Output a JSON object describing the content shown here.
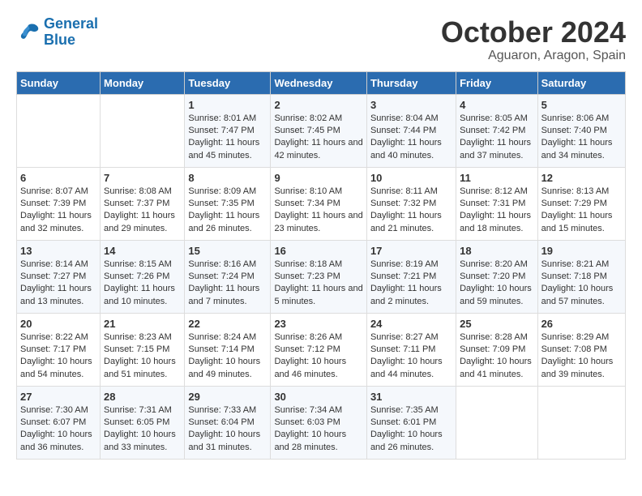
{
  "header": {
    "logo_line1": "General",
    "logo_line2": "Blue",
    "month": "October 2024",
    "location": "Aguaron, Aragon, Spain"
  },
  "days_of_week": [
    "Sunday",
    "Monday",
    "Tuesday",
    "Wednesday",
    "Thursday",
    "Friday",
    "Saturday"
  ],
  "weeks": [
    [
      {
        "day": "",
        "info": ""
      },
      {
        "day": "",
        "info": ""
      },
      {
        "day": "1",
        "info": "Sunrise: 8:01 AM\nSunset: 7:47 PM\nDaylight: 11 hours and 45 minutes."
      },
      {
        "day": "2",
        "info": "Sunrise: 8:02 AM\nSunset: 7:45 PM\nDaylight: 11 hours and 42 minutes."
      },
      {
        "day": "3",
        "info": "Sunrise: 8:04 AM\nSunset: 7:44 PM\nDaylight: 11 hours and 40 minutes."
      },
      {
        "day": "4",
        "info": "Sunrise: 8:05 AM\nSunset: 7:42 PM\nDaylight: 11 hours and 37 minutes."
      },
      {
        "day": "5",
        "info": "Sunrise: 8:06 AM\nSunset: 7:40 PM\nDaylight: 11 hours and 34 minutes."
      }
    ],
    [
      {
        "day": "6",
        "info": "Sunrise: 8:07 AM\nSunset: 7:39 PM\nDaylight: 11 hours and 32 minutes."
      },
      {
        "day": "7",
        "info": "Sunrise: 8:08 AM\nSunset: 7:37 PM\nDaylight: 11 hours and 29 minutes."
      },
      {
        "day": "8",
        "info": "Sunrise: 8:09 AM\nSunset: 7:35 PM\nDaylight: 11 hours and 26 minutes."
      },
      {
        "day": "9",
        "info": "Sunrise: 8:10 AM\nSunset: 7:34 PM\nDaylight: 11 hours and 23 minutes."
      },
      {
        "day": "10",
        "info": "Sunrise: 8:11 AM\nSunset: 7:32 PM\nDaylight: 11 hours and 21 minutes."
      },
      {
        "day": "11",
        "info": "Sunrise: 8:12 AM\nSunset: 7:31 PM\nDaylight: 11 hours and 18 minutes."
      },
      {
        "day": "12",
        "info": "Sunrise: 8:13 AM\nSunset: 7:29 PM\nDaylight: 11 hours and 15 minutes."
      }
    ],
    [
      {
        "day": "13",
        "info": "Sunrise: 8:14 AM\nSunset: 7:27 PM\nDaylight: 11 hours and 13 minutes."
      },
      {
        "day": "14",
        "info": "Sunrise: 8:15 AM\nSunset: 7:26 PM\nDaylight: 11 hours and 10 minutes."
      },
      {
        "day": "15",
        "info": "Sunrise: 8:16 AM\nSunset: 7:24 PM\nDaylight: 11 hours and 7 minutes."
      },
      {
        "day": "16",
        "info": "Sunrise: 8:18 AM\nSunset: 7:23 PM\nDaylight: 11 hours and 5 minutes."
      },
      {
        "day": "17",
        "info": "Sunrise: 8:19 AM\nSunset: 7:21 PM\nDaylight: 11 hours and 2 minutes."
      },
      {
        "day": "18",
        "info": "Sunrise: 8:20 AM\nSunset: 7:20 PM\nDaylight: 10 hours and 59 minutes."
      },
      {
        "day": "19",
        "info": "Sunrise: 8:21 AM\nSunset: 7:18 PM\nDaylight: 10 hours and 57 minutes."
      }
    ],
    [
      {
        "day": "20",
        "info": "Sunrise: 8:22 AM\nSunset: 7:17 PM\nDaylight: 10 hours and 54 minutes."
      },
      {
        "day": "21",
        "info": "Sunrise: 8:23 AM\nSunset: 7:15 PM\nDaylight: 10 hours and 51 minutes."
      },
      {
        "day": "22",
        "info": "Sunrise: 8:24 AM\nSunset: 7:14 PM\nDaylight: 10 hours and 49 minutes."
      },
      {
        "day": "23",
        "info": "Sunrise: 8:26 AM\nSunset: 7:12 PM\nDaylight: 10 hours and 46 minutes."
      },
      {
        "day": "24",
        "info": "Sunrise: 8:27 AM\nSunset: 7:11 PM\nDaylight: 10 hours and 44 minutes."
      },
      {
        "day": "25",
        "info": "Sunrise: 8:28 AM\nSunset: 7:09 PM\nDaylight: 10 hours and 41 minutes."
      },
      {
        "day": "26",
        "info": "Sunrise: 8:29 AM\nSunset: 7:08 PM\nDaylight: 10 hours and 39 minutes."
      }
    ],
    [
      {
        "day": "27",
        "info": "Sunrise: 7:30 AM\nSunset: 6:07 PM\nDaylight: 10 hours and 36 minutes."
      },
      {
        "day": "28",
        "info": "Sunrise: 7:31 AM\nSunset: 6:05 PM\nDaylight: 10 hours and 33 minutes."
      },
      {
        "day": "29",
        "info": "Sunrise: 7:33 AM\nSunset: 6:04 PM\nDaylight: 10 hours and 31 minutes."
      },
      {
        "day": "30",
        "info": "Sunrise: 7:34 AM\nSunset: 6:03 PM\nDaylight: 10 hours and 28 minutes."
      },
      {
        "day": "31",
        "info": "Sunrise: 7:35 AM\nSunset: 6:01 PM\nDaylight: 10 hours and 26 minutes."
      },
      {
        "day": "",
        "info": ""
      },
      {
        "day": "",
        "info": ""
      }
    ]
  ]
}
